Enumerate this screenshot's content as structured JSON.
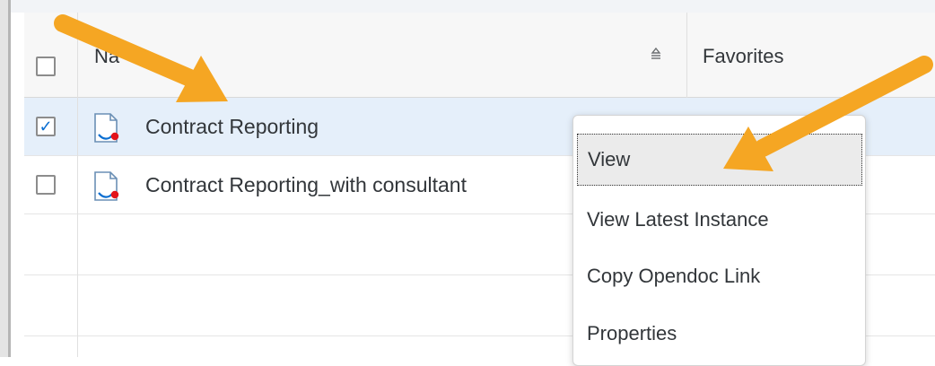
{
  "table": {
    "header": {
      "name_label": "Na",
      "favorites_label": "Favorites"
    },
    "rows": [
      {
        "name": "Contract Reporting",
        "checked": true,
        "selected": true,
        "icon": "report-document-icon"
      },
      {
        "name": "Contract Reporting_with consultant",
        "checked": false,
        "selected": false,
        "icon": "report-document-icon"
      }
    ],
    "check_glyph": "✓"
  },
  "context_menu": {
    "items": [
      {
        "label": "View",
        "highlighted": true
      },
      {
        "label": "View Latest Instance"
      },
      {
        "label": "Copy Opendoc Link"
      },
      {
        "label": "Properties"
      }
    ]
  },
  "annotations": {
    "arrow_color": "#f5a623"
  },
  "colors": {
    "selected_row": "#e5effa",
    "checkbox_check": "#0a6ed1",
    "report_icon_dot": "#e3141b",
    "report_icon_curve": "#0a6ed1"
  }
}
